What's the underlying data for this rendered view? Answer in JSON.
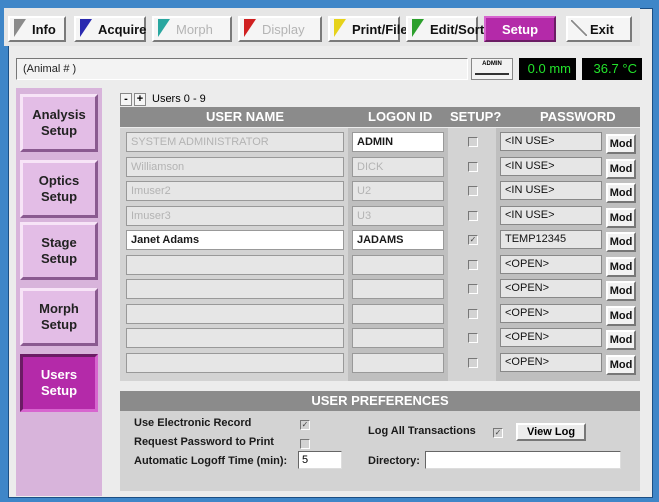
{
  "menubar": {
    "items": [
      {
        "label": "Info",
        "color": "#8a8a8a",
        "enabled": true
      },
      {
        "label": "Acquire",
        "color": "#2a2ab0",
        "enabled": true
      },
      {
        "label": "Morph",
        "color": "#2aa7a0",
        "enabled": false
      },
      {
        "label": "Display",
        "color": "#d02020",
        "enabled": false
      },
      {
        "label": "Print/File",
        "color": "#e6d21a",
        "enabled": true
      },
      {
        "label": "Edit/Sort",
        "color": "#2ca02c",
        "enabled": true
      },
      {
        "label": "Setup",
        "color": "#b42aa9",
        "enabled": true,
        "active": true
      },
      {
        "label": "Exit",
        "color": "#8a8a8a",
        "enabled": true
      }
    ]
  },
  "status": {
    "animal": "(Animal # )",
    "admin_badge": "ADMIN",
    "depth": "0.0 mm",
    "temperature": "36.7 °C"
  },
  "sidebar": {
    "items": [
      {
        "label": "Analysis Setup",
        "active": false
      },
      {
        "label": "Optics Setup",
        "active": false
      },
      {
        "label": "Stage Setup",
        "active": false
      },
      {
        "label": "Morph Setup",
        "active": false
      },
      {
        "label": "Users Setup",
        "active": true
      }
    ]
  },
  "users": {
    "pager": {
      "minus": "-",
      "plus": "+",
      "range": "Users 0 - 9"
    },
    "headers": {
      "user_name": "USER NAME",
      "logon_id": "LOGON ID",
      "setup": "SETUP?",
      "password": "PASSWORD"
    },
    "mod_label": "Mod",
    "rows": [
      {
        "name": "SYSTEM ADMINISTRATOR",
        "logon": "ADMIN",
        "setup": false,
        "password": "<IN USE>",
        "name_dim": true,
        "logon_dim": false,
        "logon_white": true,
        "name_white": false
      },
      {
        "name": "Williamson",
        "logon": "DICK",
        "setup": false,
        "password": "<IN USE>",
        "name_dim": true,
        "logon_dim": true,
        "logon_white": false,
        "name_white": false
      },
      {
        "name": "Imuser2",
        "logon": "U2",
        "setup": false,
        "password": "<IN USE>",
        "name_dim": true,
        "logon_dim": true,
        "logon_white": false,
        "name_white": false
      },
      {
        "name": "Imuser3",
        "logon": "U3",
        "setup": false,
        "password": "<IN USE>",
        "name_dim": true,
        "logon_dim": true,
        "logon_white": false,
        "name_white": false
      },
      {
        "name": "Janet Adams",
        "logon": "JADAMS",
        "setup": true,
        "password": "TEMP12345",
        "name_dim": false,
        "logon_dim": false,
        "logon_white": true,
        "name_white": true
      },
      {
        "name": "",
        "logon": "",
        "setup": false,
        "password": "<OPEN>",
        "name_dim": false,
        "logon_dim": false,
        "logon_white": false,
        "name_white": false
      },
      {
        "name": "",
        "logon": "",
        "setup": false,
        "password": "<OPEN>",
        "name_dim": false,
        "logon_dim": false,
        "logon_white": false,
        "name_white": false
      },
      {
        "name": "",
        "logon": "",
        "setup": false,
        "password": "<OPEN>",
        "name_dim": false,
        "logon_dim": false,
        "logon_white": false,
        "name_white": false
      },
      {
        "name": "",
        "logon": "",
        "setup": false,
        "password": "<OPEN>",
        "name_dim": false,
        "logon_dim": false,
        "logon_white": false,
        "name_white": false
      },
      {
        "name": "",
        "logon": "",
        "setup": false,
        "password": "<OPEN>",
        "name_dim": false,
        "logon_dim": false,
        "logon_white": false,
        "name_white": false
      }
    ]
  },
  "prefs": {
    "title": "USER PREFERENCES",
    "electronic_record_label": "Use Electronic Record",
    "electronic_record": true,
    "request_password_label": "Request Password to Print",
    "request_password": false,
    "logoff_label": "Automatic Logoff Time (min):",
    "logoff_value": "5",
    "log_all_label": "Log All Transactions",
    "log_all": true,
    "view_log_label": "View Log",
    "directory_label": "Directory:",
    "directory_value": ""
  }
}
